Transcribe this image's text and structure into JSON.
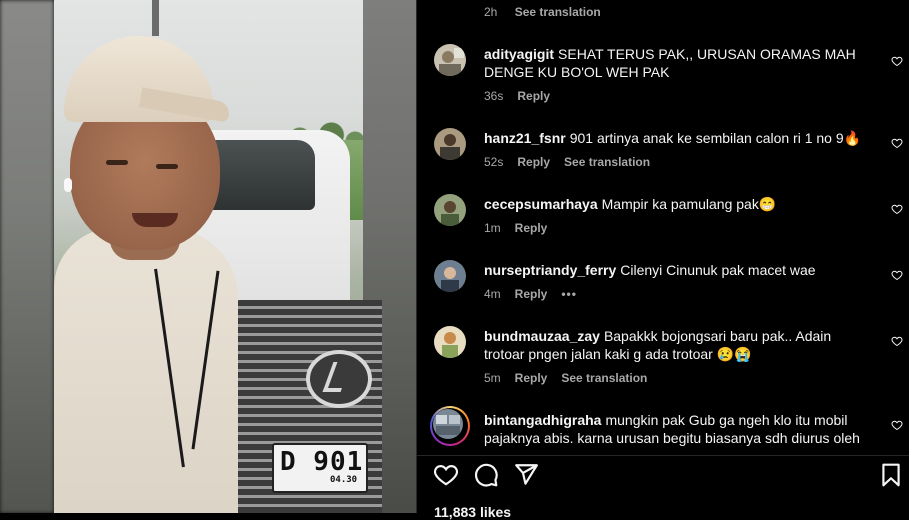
{
  "media": {
    "plate_main": "D 901",
    "plate_sub": "04.30"
  },
  "header_meta": {
    "time": "2h",
    "translate": "See translation"
  },
  "comments": [
    {
      "username": "adityagigit",
      "text": "SEHAT TERUS PAK,, URUSAN ORAMAS MAH DENGE KU BO'OL WEH PAK",
      "time": "36s",
      "reply": "Reply",
      "translate": ""
    },
    {
      "username": "hanz21_fsnr",
      "text": "901 artinya anak ke sembilan calon ri 1 no 9🔥",
      "time": "52s",
      "reply": "Reply",
      "translate": "See translation"
    },
    {
      "username": "cecepsumarhaya",
      "text": "Mampir ka pamulang pak😁",
      "time": "1m",
      "reply": "Reply",
      "translate": ""
    },
    {
      "username": "nurseptriandy_ferry",
      "text": "Cilenyi Cinunuk pak macet wae",
      "time": "4m",
      "reply": "Reply",
      "translate": "",
      "more": "•••"
    },
    {
      "username": "bundmauzaa_zay",
      "text": "Bapakkk bojongsari baru pak.. Adain trotoar pngen jalan kaki g ada trotoar 😢😭",
      "time": "5m",
      "reply": "Reply",
      "translate": "See translation"
    },
    {
      "username": "bintangadhigraha",
      "text": "mungkin pak Gub ga ngeh klo itu mobil pajaknya abis. karna urusan begitu biasanya sdh diurus oleh",
      "time": "",
      "reply": "",
      "translate": ""
    }
  ],
  "footer": {
    "likes": "11,883 likes"
  },
  "icons": {
    "like": "heart-icon",
    "comment": "comment-icon",
    "share": "send-icon",
    "save": "bookmark-icon"
  },
  "colors": {
    "background": "#000000",
    "text": "#f5f5f5",
    "secondary": "#a8a8a8"
  }
}
